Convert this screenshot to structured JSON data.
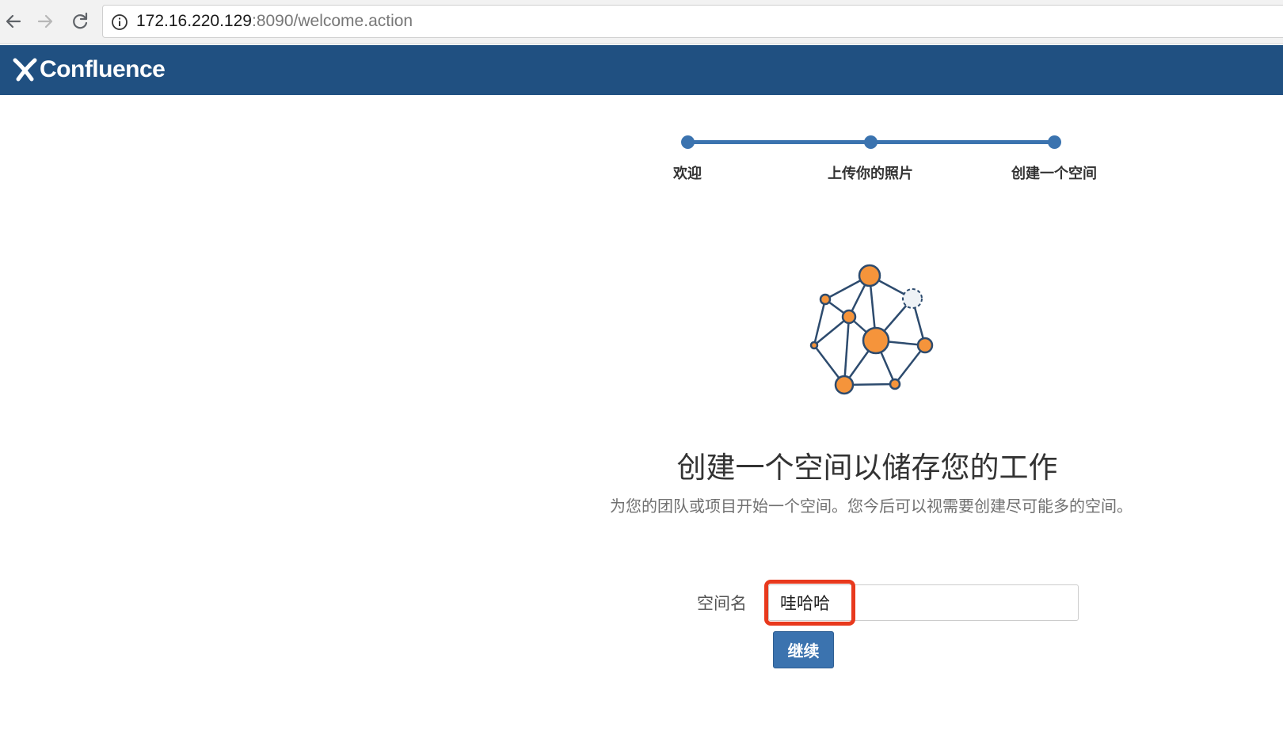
{
  "browser": {
    "url_host": "172.16.220.129",
    "url_rest": ":8090/welcome.action",
    "icons": {
      "back": "arrow-left-icon",
      "forward": "arrow-right-icon",
      "reload": "reload-icon",
      "info": "info-icon"
    }
  },
  "header": {
    "logo_text": "Confluence",
    "background_color": "#205081"
  },
  "progress": {
    "steps": [
      {
        "label": "欢迎"
      },
      {
        "label": "上传你的照片"
      },
      {
        "label": "创建一个空间"
      }
    ],
    "accent_color": "#3b73af"
  },
  "main": {
    "illustration": "network-nodes-icon",
    "title": "创建一个空间以储存您的工作",
    "description": "为您的团队或项目开始一个空间。您今后可以视需要创建尽可能多的空间。"
  },
  "form": {
    "space_name_label": "空间名",
    "space_name_value": "哇哈哈",
    "continue_label": "继续",
    "highlight_color": "#e8391d"
  }
}
